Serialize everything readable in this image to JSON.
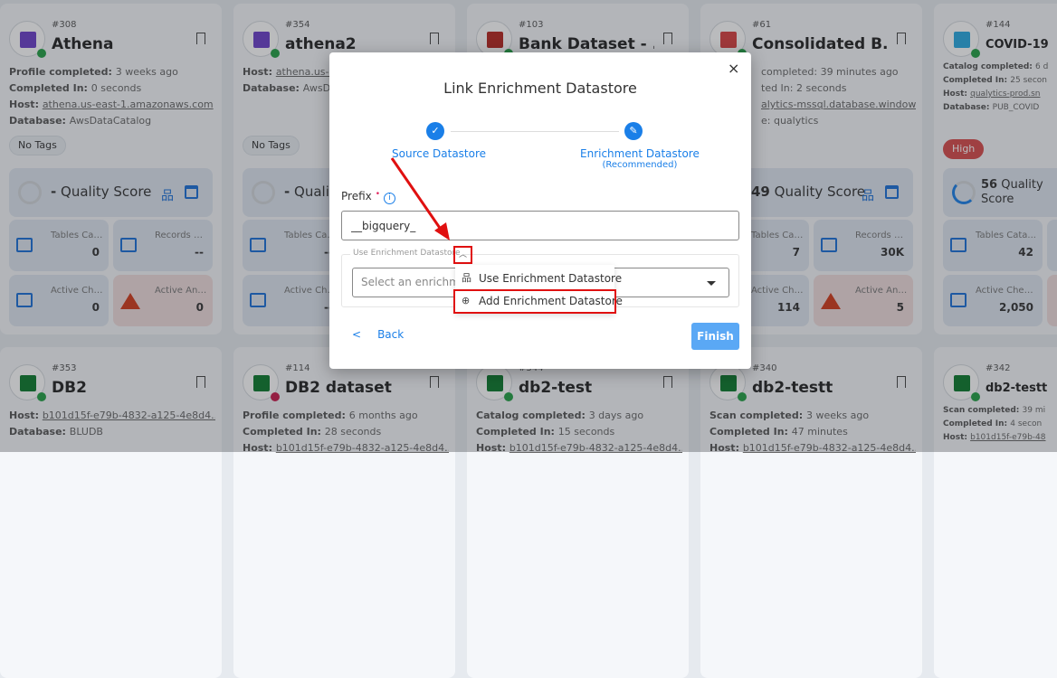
{
  "cards": [
    {
      "id": "#308",
      "name": "Athena",
      "logo": "#6b3fc9",
      "status": "#22a045",
      "lines": [
        [
          "Profile completed: ",
          "3 weeks ago"
        ],
        [
          "Completed In: ",
          "0 seconds"
        ],
        [
          "Host: ",
          "athena.us-east-1.amazonaws.com",
          true
        ],
        [
          "Database: ",
          "AwsDataCatalog"
        ]
      ],
      "tag": "No Tags",
      "score": "-",
      "tables": "0",
      "records": "--",
      "checks": "0",
      "anomalies": "0"
    },
    {
      "id": "#354",
      "name": "athena2",
      "logo": "#6b3fc9",
      "status": "#22a045",
      "lines": [
        [
          "Host: ",
          "athena.us-e",
          true
        ],
        [
          "Database: ",
          "AwsDa"
        ]
      ],
      "tag": "No Tags",
      "score": "-",
      "tables": "--",
      "records": "",
      "checks": "--",
      "anomalies": ""
    },
    {
      "id": "#103",
      "name": "Bank Dataset - ...",
      "logo": "#b5261e",
      "status": "#22a045",
      "lines": [],
      "tag": "",
      "score": "",
      "tables": "",
      "records": "",
      "checks": "",
      "anomalies": ""
    },
    {
      "id": "#61",
      "name": "Consolidated B...",
      "logo": "#d84040",
      "status": "#22a045",
      "lines": [
        [
          "",
          "completed: 39 minutes ago"
        ],
        [
          "",
          "ted In: 2 seconds"
        ],
        [
          "",
          "alytics-mssql.database.window...",
          true
        ],
        [
          "",
          "e: qualytics"
        ]
      ],
      "tag": "",
      "score": "49",
      "tables": "7",
      "records": "30K",
      "checks": "114",
      "anomalies": "5"
    },
    {
      "id": "#144",
      "name": "COVID-19",
      "logo": "#29a8e0",
      "status": "#22a045",
      "lines": [
        [
          "Catalog completed: ",
          "6 d"
        ],
        [
          "Completed In: ",
          "25 secon"
        ],
        [
          "Host: ",
          "qualytics-prod.sn",
          true
        ],
        [
          "Database: ",
          "PUB_COVID"
        ]
      ],
      "tag": "High",
      "score": "56",
      "tables": "42",
      "records": "",
      "checks": "2,050",
      "anomalies": ""
    },
    {
      "id": "#353",
      "name": "DB2",
      "logo": "#0b7a2c",
      "status": "#22a045",
      "lines": [
        [
          "Host: ",
          "b101d15f-e79b-4832-a125-4e8d4...",
          true
        ],
        [
          "Database: ",
          "BLUDB"
        ]
      ]
    },
    {
      "id": "#114",
      "name": "DB2 dataset",
      "logo": "#0b7a2c",
      "status": "#c8184a",
      "lines": [
        [
          "Profile completed: ",
          "6 months ago"
        ],
        [
          "Completed In: ",
          "28 seconds"
        ],
        [
          "Host: ",
          "b101d15f-e79b-4832-a125-4e8d4...",
          true
        ]
      ]
    },
    {
      "id": "#344",
      "name": "db2-test",
      "logo": "#0b7a2c",
      "status": "#22a045",
      "lines": [
        [
          "Catalog completed: ",
          "3 days ago"
        ],
        [
          "Completed In: ",
          "15 seconds"
        ],
        [
          "Host: ",
          "b101d15f-e79b-4832-a125-4e8d4...",
          true
        ]
      ]
    },
    {
      "id": "#340",
      "name": "db2-testt",
      "logo": "#0b7a2c",
      "status": "#22a045",
      "lines": [
        [
          "Scan completed: ",
          "3 weeks ago"
        ],
        [
          "Completed In: ",
          "47 minutes"
        ],
        [
          "Host: ",
          "b101d15f-e79b-4832-a125-4e8d4...",
          true
        ]
      ]
    },
    {
      "id": "#342",
      "name": "db2-testt",
      "logo": "#0b7a2c",
      "status": "#22a045",
      "lines": [
        [
          "Scan completed: ",
          "39 mi"
        ],
        [
          "Completed In: ",
          "4 secon"
        ],
        [
          "Host: ",
          "b101d15f-e79b-48",
          true
        ]
      ]
    }
  ],
  "labels": {
    "quality": "Quality Score",
    "tables": "Tables Cata...",
    "records": "Records Pro...",
    "checks": "Active Chec...",
    "anomalies": "Active Ano..."
  },
  "modal": {
    "title": "Link Enrichment Datastore",
    "close": "×",
    "step1": "Source Datastore",
    "step2": "Enrichment Datastore",
    "step2_sub": "(Recommended)",
    "prefix_label": "Prefix",
    "prefix_required": "•",
    "prefix_value": "__bigquery_",
    "fieldset_label": "Use Enrichment Datastore",
    "select_placeholder": "Select an enrichme",
    "menu": [
      "Use Enrichment Datastore",
      "Add Enrichment Datastore"
    ],
    "back": "Back",
    "finish": "Finish"
  },
  "colors": {
    "accent": "#1a7fe8",
    "highlight": "#e01010",
    "finish": "#5aa8f5"
  }
}
